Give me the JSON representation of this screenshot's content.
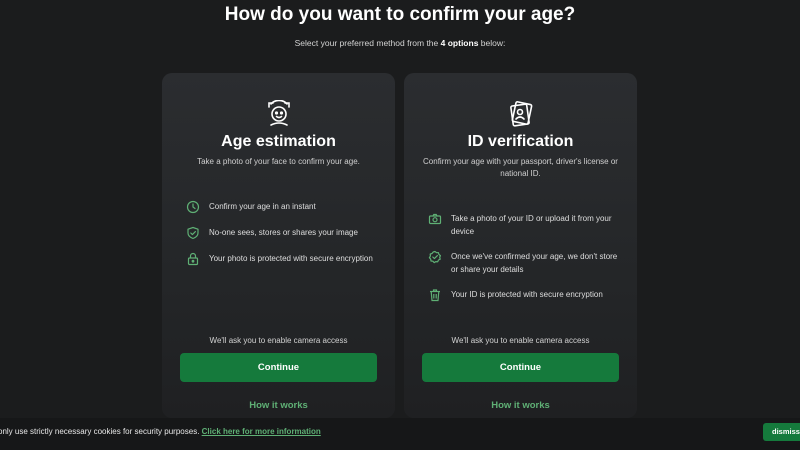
{
  "header": {
    "title": "How do you want to confirm your age?",
    "subtitle_prefix": "Select your preferred method from the ",
    "subtitle_bold": "4 options",
    "subtitle_suffix": " below:"
  },
  "colors": {
    "accent": "#157a3c",
    "link": "#5fb075",
    "icon": "#5fb075",
    "background": "#1b1c1d",
    "card": "#2b2d30"
  },
  "cards": [
    {
      "icon": "face-scan-icon",
      "title": "Age estimation",
      "description": "Take a photo of your face to confirm your age.",
      "features": [
        {
          "icon": "clock-icon",
          "text": "Confirm your age in an instant"
        },
        {
          "icon": "shield-check-icon",
          "text": "No-one sees, stores or shares your image"
        },
        {
          "icon": "lock-icon",
          "text": "Your photo is protected with secure encryption"
        }
      ],
      "camera_note": "We'll ask you to enable camera access",
      "continue_label": "Continue",
      "how_label": "How it works"
    },
    {
      "icon": "id-card-icon",
      "title": "ID verification",
      "description": "Confirm your age with your passport, driver's license or national ID.",
      "features": [
        {
          "icon": "camera-icon",
          "text": "Take a photo of your ID or upload it from your device"
        },
        {
          "icon": "badge-check-icon",
          "text": "Once we've confirmed your age, we don't store or share your details"
        },
        {
          "icon": "trash-icon",
          "text": "Your ID is protected with secure encryption"
        }
      ],
      "camera_note": "We'll ask you to enable camera access",
      "continue_label": "Continue",
      "how_label": "How it works"
    }
  ],
  "cookie": {
    "text": "only use strictly necessary cookies for security purposes. ",
    "link": "Click here for more information",
    "dismiss": "dismiss"
  }
}
